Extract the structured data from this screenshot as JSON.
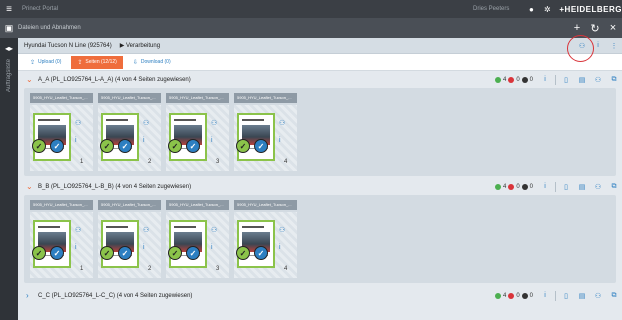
{
  "topbar": {
    "title": "Prinect Portal",
    "user": "Dries Peeters",
    "brand": "HEIDELBERG"
  },
  "secondary": {
    "title": "Dateien und Abnahmen"
  },
  "leftrail": {
    "label": "Auftragsliste"
  },
  "job": {
    "title": "Hyundai Tucson N Line (925764)",
    "status": "Verarbeitung"
  },
  "tabs": [
    {
      "label": "Upload (0)"
    },
    {
      "label": "Seiten (12/12)"
    },
    {
      "label": "Download (0)"
    }
  ],
  "groups": [
    {
      "title": "A_A (PL_LO925764_L-A_A) (4 von 4 Seiten zugewiesen)",
      "counts": {
        "green": "4",
        "red": "0",
        "dark": "0"
      },
      "pages": [
        {
          "label": "5905_HYU_Leaflet_Tucson_...",
          "num": "1"
        },
        {
          "label": "5905_HYU_Leaflet_Tucson_...",
          "num": "2"
        },
        {
          "label": "5905_HYU_Leaflet_Tucson_...",
          "num": "3"
        },
        {
          "label": "5905_HYU_Leaflet_Tucson_...",
          "num": "4"
        }
      ]
    },
    {
      "title": "B_B (PL_LO925764_L-B_B) (4 von 4 Seiten zugewiesen)",
      "counts": {
        "green": "4",
        "red": "0",
        "dark": "0"
      },
      "pages": [
        {
          "label": "5905_HYU_Leaflet_Tucson_...",
          "num": "1"
        },
        {
          "label": "5905_HYU_Leaflet_Tucson_...",
          "num": "2"
        },
        {
          "label": "5905_HYU_Leaflet_Tucson_...",
          "num": "3"
        },
        {
          "label": "5905_HYU_Leaflet_Tucson_...",
          "num": "4"
        }
      ]
    },
    {
      "title": "C_C (PL_LO925764_L-C_C) (4 von 4 Seiten zugewiesen)",
      "counts": {
        "green": "4",
        "red": "0",
        "dark": "0"
      }
    }
  ]
}
